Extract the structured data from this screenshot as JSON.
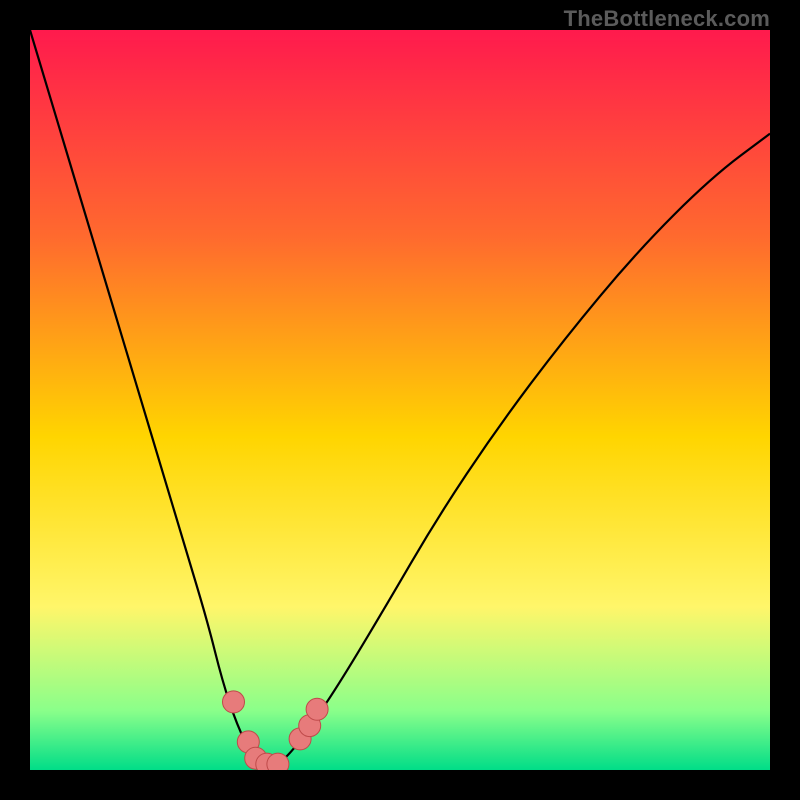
{
  "watermark": "TheBottleneck.com",
  "colors": {
    "frame": "#000000",
    "gradient_top": "#ff1a4d",
    "gradient_mid1": "#ff6a2e",
    "gradient_mid2": "#ffd500",
    "gradient_mid3": "#fff66a",
    "gradient_low": "#8aff8a",
    "gradient_bottom": "#00dd88",
    "curve": "#000000",
    "marker_fill": "#e77b7b",
    "marker_stroke": "#bf4a4a"
  },
  "chart_data": {
    "type": "line",
    "title": "",
    "xlabel": "",
    "ylabel": "",
    "xlim": [
      0,
      100
    ],
    "ylim": [
      0,
      100
    ],
    "x": [
      0,
      3,
      6,
      9,
      12,
      15,
      18,
      21,
      24,
      26,
      28,
      30,
      31.5,
      33,
      35,
      38,
      42,
      48,
      55,
      63,
      72,
      82,
      92,
      100
    ],
    "y": [
      100,
      90,
      80,
      70,
      60,
      50,
      40,
      30,
      20,
      12,
      6,
      2,
      0.5,
      0.5,
      2,
      6,
      12,
      22,
      34,
      46,
      58,
      70,
      80,
      86
    ],
    "markers": [
      {
        "x": 27.5,
        "y": 9.2
      },
      {
        "x": 29.5,
        "y": 3.8
      },
      {
        "x": 30.5,
        "y": 1.6
      },
      {
        "x": 32.0,
        "y": 0.8
      },
      {
        "x": 33.5,
        "y": 0.8
      },
      {
        "x": 36.5,
        "y": 4.2
      },
      {
        "x": 37.8,
        "y": 6.0
      },
      {
        "x": 38.8,
        "y": 8.2
      }
    ]
  }
}
